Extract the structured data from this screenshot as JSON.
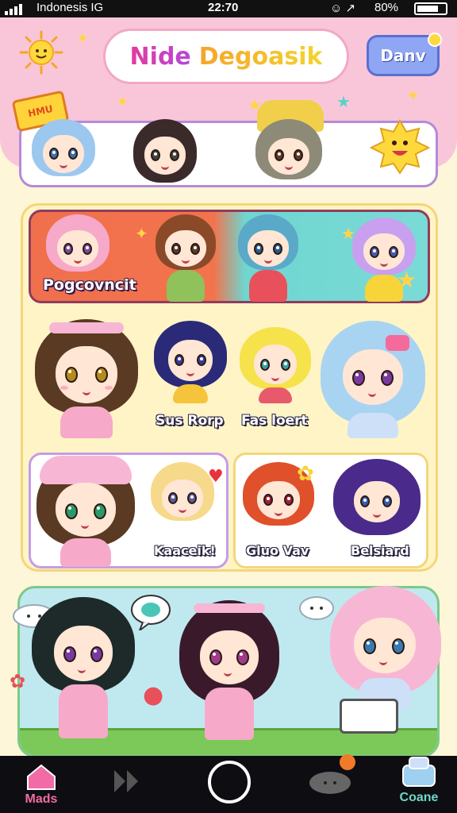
{
  "status_bar": {
    "carrier": "Indonesis  IG",
    "time": "22:70",
    "icons": "☺ ↗",
    "battery": "80%"
  },
  "header": {
    "title_part1": "Nide",
    "title_part2": "Degoasik",
    "button_label": "Danv"
  },
  "badge": {
    "crown_text": "HMU"
  },
  "main": {
    "banner_label": "Pogcovncit",
    "row2_caption_left": "Sus Rorp",
    "row2_caption_right": "Fas loert",
    "cards": [
      {
        "label": "Kaaceik!"
      },
      {
        "label": "Gluo Vav"
      },
      {
        "label": "Belsiard"
      }
    ]
  },
  "nav": {
    "left_label": "Mads",
    "right_label": "Coane"
  },
  "colors": {
    "header_pink": "#f9c6d9",
    "panel_yellow": "#fef4c6",
    "banner_orange": "#f0704d",
    "banner_teal": "#6fd6d0",
    "accent_purple": "#b48ad9",
    "nav_dark": "#0e0e12"
  },
  "icons": [
    "sun-icon",
    "star-icon",
    "crown-icon",
    "speech-bubble-icon",
    "cloud-icon",
    "home-icon",
    "play-icon",
    "camera-shutter-icon",
    "weather-cloud-icon",
    "bed-icon"
  ]
}
